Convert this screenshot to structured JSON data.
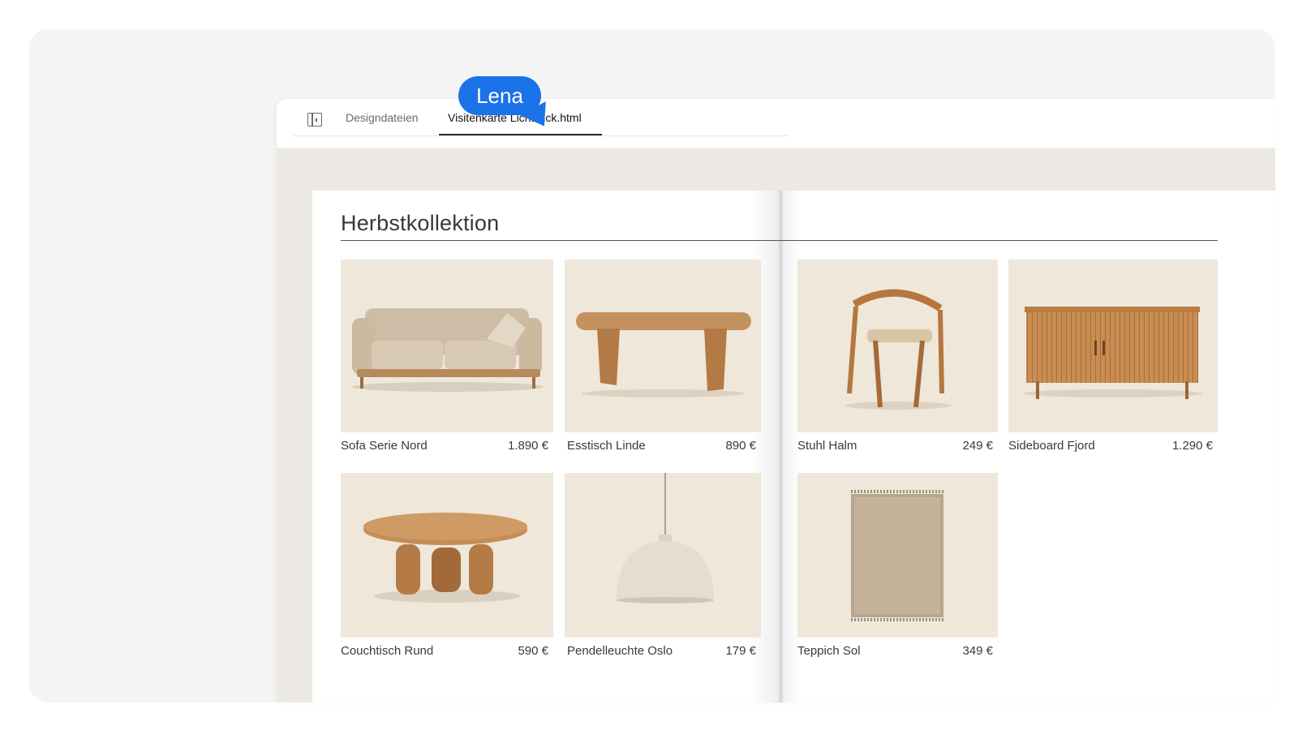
{
  "tabs": {
    "items": [
      {
        "label": "Designdateien"
      },
      {
        "label": "Visitenkarte Lichtblick.html"
      }
    ]
  },
  "collaborator": {
    "name": "Lena",
    "color": "#1a73e8"
  },
  "catalog": {
    "heading": "Herbstkollektion",
    "products": [
      {
        "name": "Sofa Serie Nord",
        "price": "1.890 €",
        "icon": "sofa-image"
      },
      {
        "name": "Esstisch Linde",
        "price": "890 €",
        "icon": "dining-table-image"
      },
      {
        "name": "Stuhl Halm",
        "price": "249 €",
        "icon": "chair-image"
      },
      {
        "name": "Sideboard Fjord",
        "price": "1.290 €",
        "icon": "sideboard-image"
      },
      {
        "name": "Couchtisch Rund",
        "price": "590 €",
        "icon": "coffee-table-image"
      },
      {
        "name": "Pendelleuchte Oslo",
        "price": "179 €",
        "icon": "pendant-lamp-image"
      },
      {
        "name": "Teppich Sol",
        "price": "349 €",
        "icon": "rug-image"
      }
    ]
  }
}
